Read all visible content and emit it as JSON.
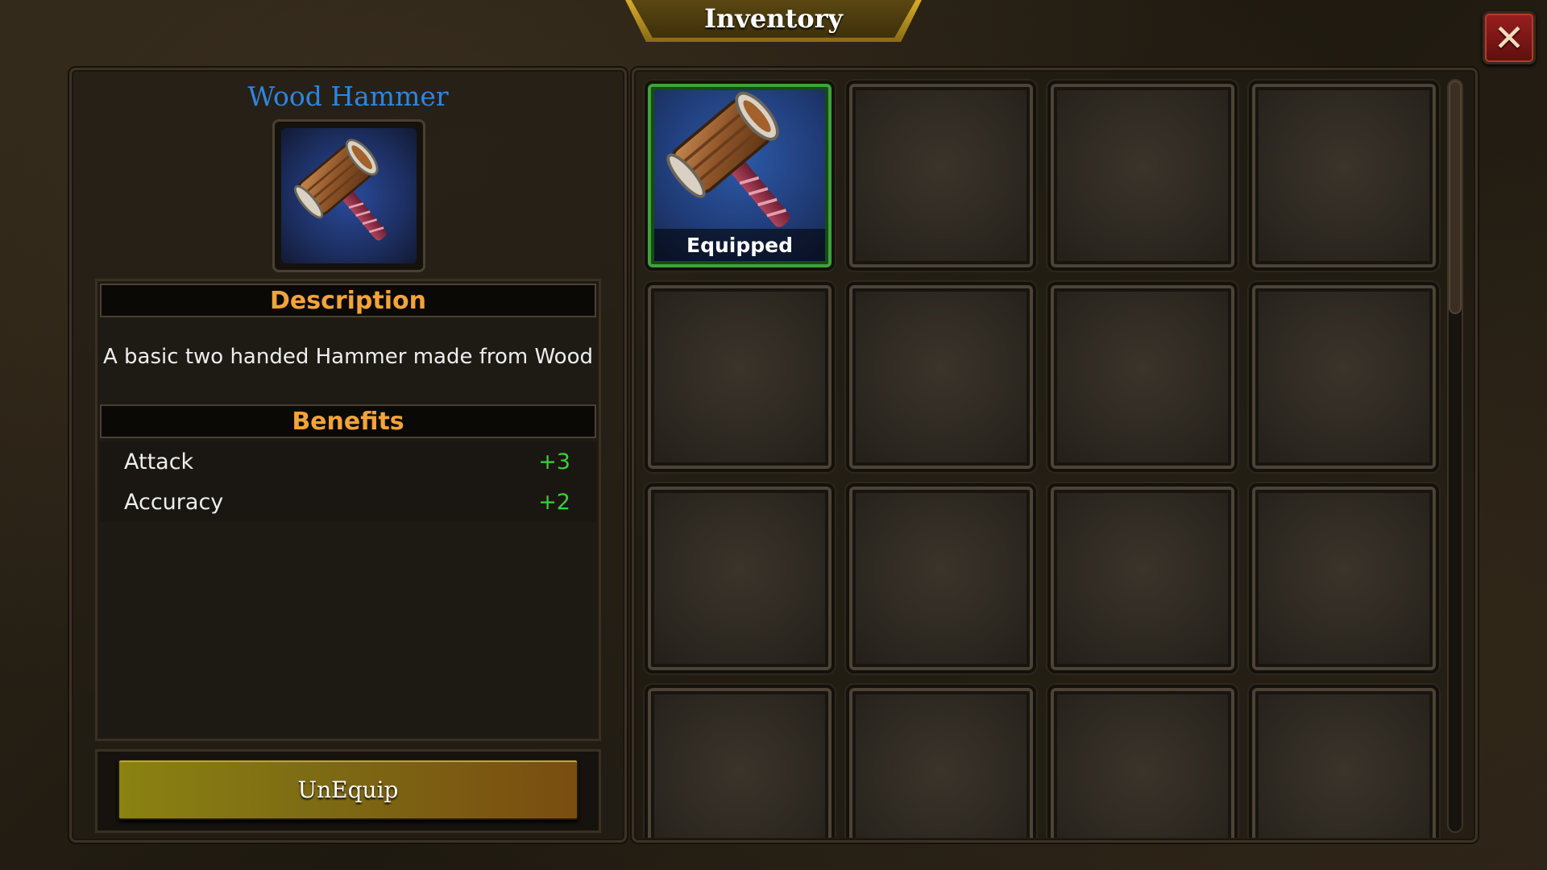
{
  "window": {
    "title": "Inventory",
    "close_icon": "close-x-icon"
  },
  "item": {
    "name": "Wood Hammer",
    "icon": "wood-hammer-icon",
    "description_header": "Description",
    "description": "A basic two handed Hammer made from Wood",
    "benefits_header": "Benefits",
    "benefits": [
      {
        "label": "Attack",
        "value": "+3"
      },
      {
        "label": "Accuracy",
        "value": "+2"
      }
    ],
    "action_label": "UnEquip"
  },
  "grid": {
    "slots": [
      {
        "item": "wood-hammer-icon",
        "status": "Equipped",
        "selected": true
      }
    ],
    "visible_empty_slots": 15
  },
  "colors": {
    "item_name": "#2d86e0",
    "section_header": "#f2a33a",
    "stat_value": "#3fcc3f",
    "equipped_border": "#3fa33a",
    "close_button": "#9a1f1f"
  }
}
